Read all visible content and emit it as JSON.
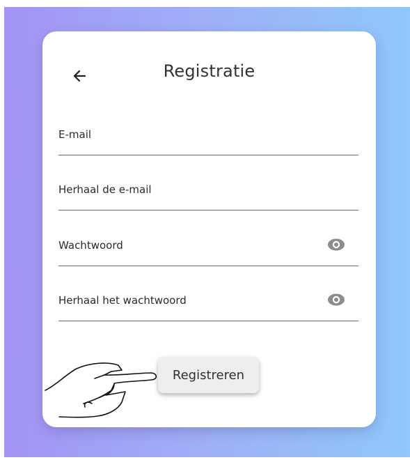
{
  "header": {
    "title": "Registratie",
    "back_icon": "arrow-left-icon"
  },
  "form": {
    "fields": [
      {
        "label": "E-mail",
        "type": "email"
      },
      {
        "label": "Herhaal de e-mail",
        "type": "email"
      },
      {
        "label": "Wachtwoord",
        "type": "password",
        "icon": "eye-icon"
      },
      {
        "label": "Herhaal het wachtwoord",
        "type": "password",
        "icon": "eye-icon"
      }
    ],
    "submit_label": "Registreren"
  },
  "pointer_icon": "pointing-hand-icon",
  "colors": {
    "gradient_start": "#a394f6",
    "gradient_end": "#8fc8fb",
    "card": "#ffffff",
    "button": "#eeeeee",
    "eye_icon": "#8c8c8c"
  }
}
